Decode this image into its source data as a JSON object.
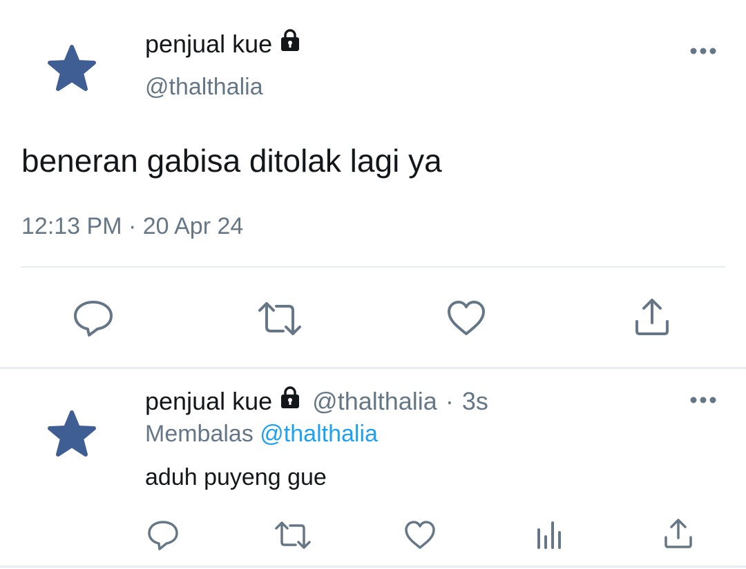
{
  "main_tweet": {
    "display_name": "penjual kue",
    "handle": "@thalthalia",
    "text": "beneran gabisa ditolak lagi ya",
    "timestamp": "12:13 PM · 20 Apr 24",
    "avatar_icon": "star-icon",
    "account_icon": "lock-icon",
    "actions": [
      "reply-icon",
      "retweet-icon",
      "like-icon",
      "share-icon"
    ]
  },
  "reply_tweet": {
    "display_name": "penjual kue",
    "handle": "@thalthalia",
    "separator": "·",
    "time_ago": "3s",
    "replying_label": "Membalas",
    "replying_to": "@thalthalia",
    "text": "aduh puyeng gue",
    "avatar_icon": "star-icon",
    "account_icon": "lock-icon",
    "actions": [
      "reply-icon",
      "retweet-icon",
      "like-icon",
      "analytics-icon",
      "share-icon"
    ]
  },
  "colors": {
    "text_primary": "#14171a",
    "text_secondary": "#657786",
    "mention": "#1da1f2",
    "avatar_star": "#3f5f94",
    "divider": "#e6ecf0"
  }
}
